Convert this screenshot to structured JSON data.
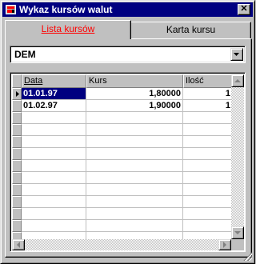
{
  "window": {
    "title": "Wykaz kursów walut",
    "close_label": "✕"
  },
  "tabs": [
    {
      "label": "Lista kursów",
      "active": true
    },
    {
      "label": "Karta kursu",
      "active": false
    }
  ],
  "currency": {
    "value": "DEM"
  },
  "grid": {
    "headers": {
      "date": "Data",
      "rate": "Kurs",
      "qty": "Ilość"
    },
    "rows": [
      {
        "date": "01.01.97",
        "rate": "1,80000",
        "qty": "1",
        "selected": true
      },
      {
        "date": "01.02.97",
        "rate": "1,90000",
        "qty": "1",
        "selected": false
      }
    ],
    "empty_rows": 11
  },
  "colors": {
    "titlebar": "#000080",
    "active_tab_text": "#ff0000",
    "selection": "#000080"
  },
  "icons": [
    "app-icon",
    "close-icon",
    "dropdown-arrow-icon",
    "row-pointer-icon",
    "scroll-up-icon",
    "scroll-down-icon",
    "scroll-left-icon",
    "scroll-right-icon",
    "size-grip-icon"
  ]
}
